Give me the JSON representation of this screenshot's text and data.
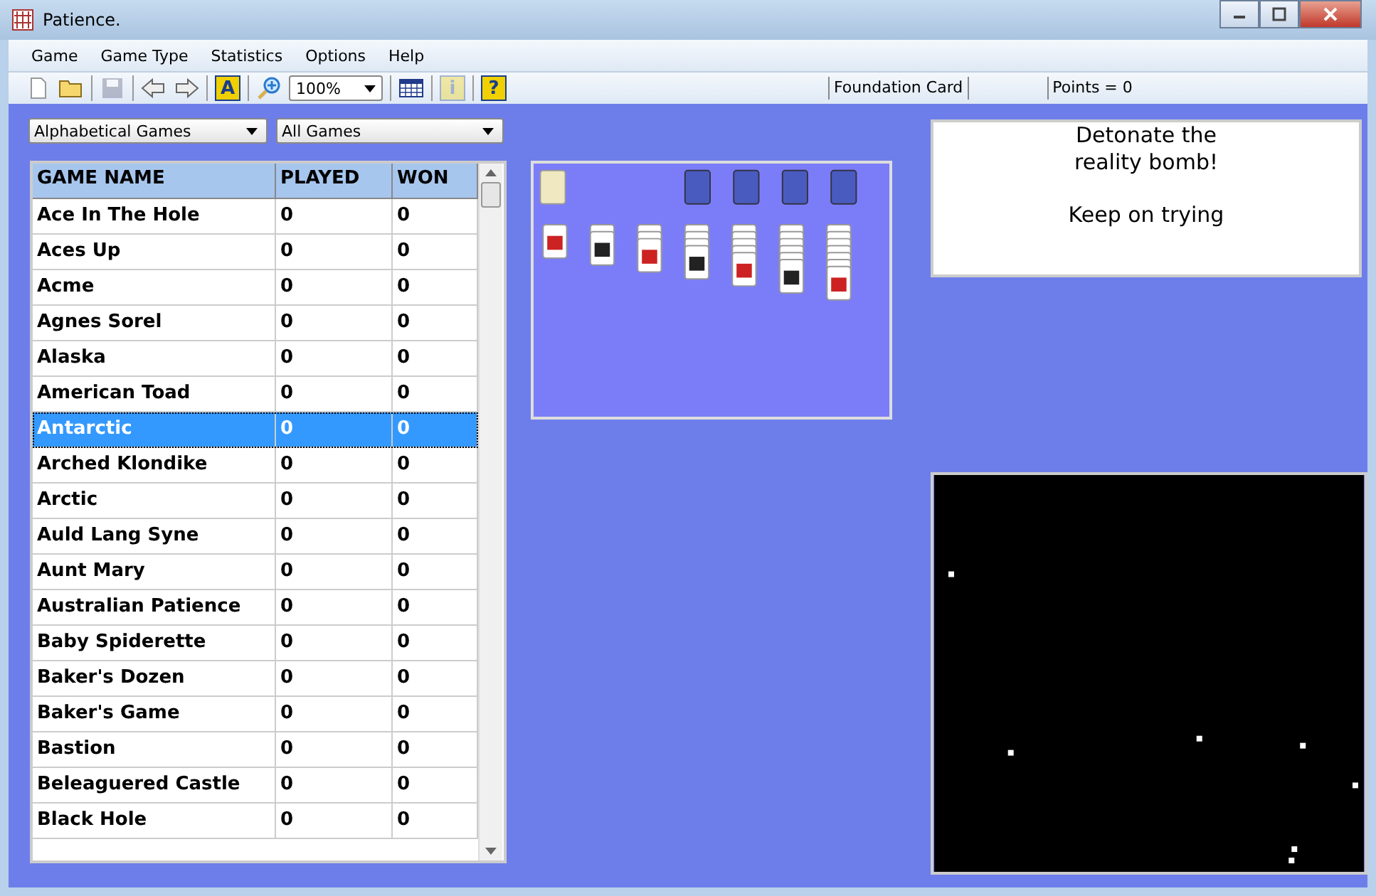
{
  "window": {
    "title": "Patience."
  },
  "menu": [
    "Game",
    "Game Type",
    "Statistics",
    "Options",
    "Help"
  ],
  "toolbar": [
    {
      "kind": "new",
      "disabled": false
    },
    {
      "kind": "open",
      "disabled": false
    },
    {
      "kind": "sep"
    },
    {
      "kind": "save",
      "disabled": true
    },
    {
      "kind": "sep"
    },
    {
      "kind": "back",
      "disabled": false
    },
    {
      "kind": "forward",
      "disabled": false
    },
    {
      "kind": "sep"
    },
    {
      "kind": "letter",
      "glyph": "A",
      "disabled": false
    },
    {
      "kind": "sep"
    },
    {
      "kind": "zoom",
      "disabled": false
    },
    {
      "kind": "combo",
      "value": "100%"
    },
    {
      "kind": "sep"
    },
    {
      "kind": "calendar",
      "disabled": false
    },
    {
      "kind": "sep"
    },
    {
      "kind": "letter",
      "glyph": "i",
      "disabled": true
    },
    {
      "kind": "sep"
    },
    {
      "kind": "letter",
      "glyph": "?",
      "disabled": false
    }
  ],
  "status_fields": [
    "Foundation Card",
    "Points = 0"
  ],
  "filters": [
    "Alphabetical Games",
    "All Games"
  ],
  "table": {
    "columns": [
      "GAME NAME",
      "PLAYED",
      "WON"
    ],
    "rows": [
      {
        "cells": [
          "Ace In The Hole",
          "0",
          "0"
        ],
        "selected": false
      },
      {
        "cells": [
          "Aces Up",
          "0",
          "0"
        ],
        "selected": false
      },
      {
        "cells": [
          "Acme",
          "0",
          "0"
        ],
        "selected": false
      },
      {
        "cells": [
          "Agnes Sorel",
          "0",
          "0"
        ],
        "selected": false
      },
      {
        "cells": [
          "Alaska",
          "0",
          "0"
        ],
        "selected": false
      },
      {
        "cells": [
          "American Toad",
          "0",
          "0"
        ],
        "selected": false
      },
      {
        "cells": [
          "Antarctic",
          "0",
          "0"
        ],
        "selected": true
      },
      {
        "cells": [
          "Arched Klondike",
          "0",
          "0"
        ],
        "selected": false
      },
      {
        "cells": [
          "Arctic",
          "0",
          "0"
        ],
        "selected": false
      },
      {
        "cells": [
          "Auld Lang Syne",
          "0",
          "0"
        ],
        "selected": false
      },
      {
        "cells": [
          "Aunt Mary",
          "0",
          "0"
        ],
        "selected": false
      },
      {
        "cells": [
          "Australian Patience",
          "0",
          "0"
        ],
        "selected": false
      },
      {
        "cells": [
          "Baby Spiderette",
          "0",
          "0"
        ],
        "selected": false
      },
      {
        "cells": [
          "Baker's Dozen",
          "0",
          "0"
        ],
        "selected": false
      },
      {
        "cells": [
          "Baker's Game",
          "0",
          "0"
        ],
        "selected": false
      },
      {
        "cells": [
          "Bastion",
          "0",
          "0"
        ],
        "selected": false
      },
      {
        "cells": [
          "Beleaguered Castle",
          "0",
          "0"
        ],
        "selected": false
      },
      {
        "cells": [
          "Black Hole",
          "0",
          "0"
        ],
        "selected": false
      }
    ]
  },
  "message": [
    "Detonate the reality bomb!",
    "Keep on trying"
  ]
}
